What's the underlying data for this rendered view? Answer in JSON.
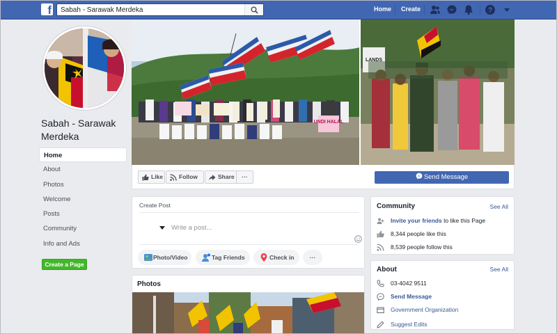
{
  "topbar": {
    "search_value": "Sabah - Sarawak Merdeka",
    "home_label": "Home",
    "create_label": "Create"
  },
  "page": {
    "name": "Sabah - Sarawak Merdeka"
  },
  "left_nav": {
    "items": [
      {
        "label": "Home",
        "active": true
      },
      {
        "label": "About"
      },
      {
        "label": "Photos"
      },
      {
        "label": "Welcome"
      },
      {
        "label": "Posts"
      },
      {
        "label": "Community"
      },
      {
        "label": "Info and Ads"
      }
    ],
    "create_page_label": "Create a Page"
  },
  "cover_signs": [
    "LANDS",
    "UNDI HALAL"
  ],
  "actions": {
    "like_label": "Like",
    "follow_label": "Follow",
    "share_label": "Share",
    "more_label": "···",
    "send_message_label": "Send Message"
  },
  "create_post": {
    "title": "Create Post",
    "placeholder": "Write a post...",
    "photo_video_label": "Photo/Video",
    "tag_friends_label": "Tag Friends",
    "check_in_label": "Check in",
    "more_label": "···"
  },
  "photos": {
    "title": "Photos"
  },
  "community": {
    "title": "Community",
    "see_all": "See All",
    "invite_link": "Invite your friends",
    "invite_rest": "to like this Page",
    "likes_text": "8,344 people like this",
    "follows_text": "8,539 people follow this"
  },
  "about": {
    "title": "About",
    "see_all": "See All",
    "phone": "03-4042 9511",
    "send_message": "Send Message",
    "category": "Government Organization",
    "suggest_edits": "Suggest Edits"
  },
  "colors": {
    "brand_blue": "#4267b2",
    "link_blue": "#385898",
    "green": "#42b72a",
    "background": "#e9ebee"
  }
}
